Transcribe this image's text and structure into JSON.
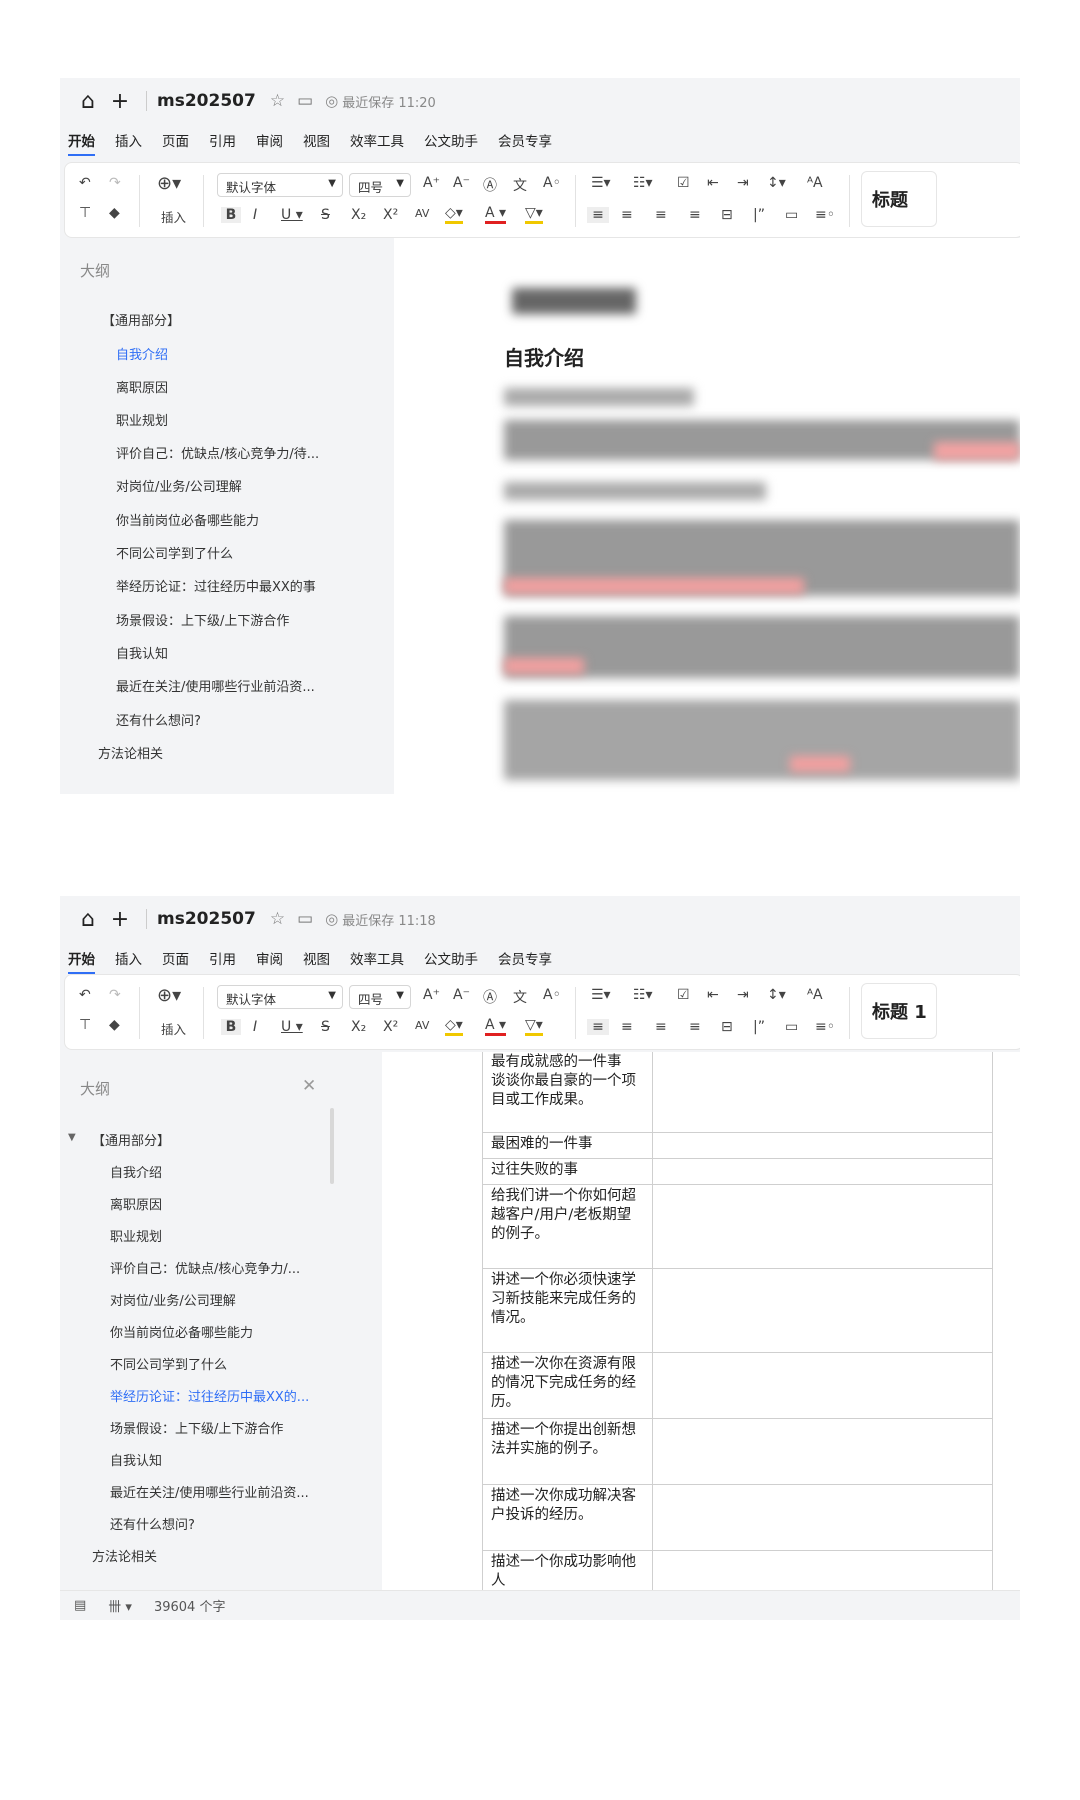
{
  "shot1": {
    "title": "ms202507",
    "save_status": "最近保存 11:20",
    "menu": [
      "开始",
      "插入",
      "页面",
      "引用",
      "审阅",
      "视图",
      "效率工具",
      "公文助手",
      "会员专享"
    ],
    "toolbar": {
      "insert_label": "插入",
      "font_name": "默认字体",
      "font_size": "四号",
      "style_label": "标题"
    },
    "outline": {
      "title": "大纲",
      "items": [
        "【通用部分】",
        "自我介绍",
        "离职原因",
        "职业规划",
        "评价自己：优缺点/核心竞争力/待...",
        "对岗位/业务/公司理解",
        "你当前岗位必备哪些能力",
        "不同公司学到了什么",
        "举经历论证：过往经历中最XX的事",
        "场景假设：上下级/上下游合作",
        "自我认知",
        "最近在关注/使用哪些行业前沿资...",
        "还有什么想问?",
        "方法论相关"
      ]
    },
    "document": {
      "heading": "自我介绍"
    }
  },
  "shot2": {
    "title": "ms202507",
    "save_status": "最近保存 11:18",
    "menu": [
      "开始",
      "插入",
      "页面",
      "引用",
      "审阅",
      "视图",
      "效率工具",
      "公文助手",
      "会员专享"
    ],
    "toolbar": {
      "insert_label": "插入",
      "font_name": "默认字体",
      "font_size": "四号",
      "style_label": "标题 1"
    },
    "outline": {
      "title": "大纲",
      "items": [
        "【通用部分】",
        "自我介绍",
        "离职原因",
        "职业规划",
        "评价自己：优缺点/核心竞争力/...",
        "对岗位/业务/公司理解",
        "你当前岗位必备哪些能力",
        "不同公司学到了什么",
        "举经历论证：过往经历中最XX的...",
        "场景假设：上下级/上下游合作",
        "自我认知",
        "最近在关注/使用哪些行业前沿资...",
        "还有什么想问?",
        "方法论相关"
      ]
    },
    "table_rows": [
      "最有成就感的一件事\n谈谈你最自豪的一个项目或工作成果。",
      "最困难的一件事",
      "过往失败的事",
      "给我们讲一个你如何超越客户/用户/老板期望的例子。",
      "讲述一个你必须快速学习新技能来完成任务的情况。",
      "描述一次你在资源有限的情况下完成任务的经历。",
      "描述一个你提出创新想法并实施的例子。",
      "描述一次你成功解决客户投诉的经历。",
      "描述一个你成功影响他人"
    ],
    "status": {
      "word_count": "39604 个字"
    }
  },
  "colors": {
    "accent": "#2f6ef5",
    "panel_bg": "#f3f4f6"
  },
  "icons": [
    "home-icon",
    "plus-icon",
    "star-icon",
    "folder-icon",
    "check-circle-icon",
    "undo-icon",
    "redo-icon",
    "format-painter-icon",
    "eraser-icon",
    "close-icon",
    "collapse-triangle-icon"
  ]
}
